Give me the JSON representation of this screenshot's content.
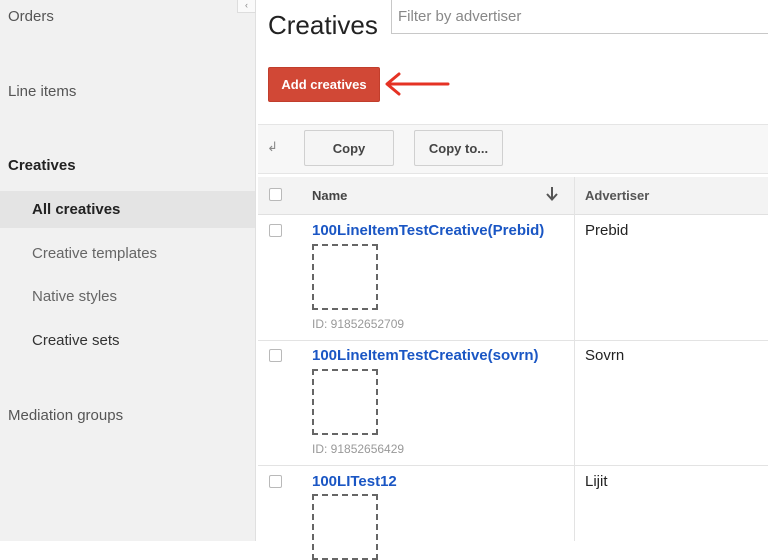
{
  "sidebar": {
    "collapse_label": "‹",
    "orders": "Orders",
    "line_items": "Line items",
    "creatives": "Creatives",
    "sub_items": [
      "All creatives",
      "Creative templates",
      "Native styles",
      "Creative sets"
    ],
    "mediation_groups": "Mediation groups"
  },
  "main": {
    "title": "Creatives",
    "filter_placeholder": "Filter by advertiser",
    "add_button": "Add creatives",
    "toolbar": {
      "sort_icon": "↲",
      "copy": "Copy",
      "copy_to": "Copy to..."
    },
    "columns": {
      "name": "Name",
      "advertiser": "Advertiser"
    },
    "rows": [
      {
        "name": "100LineItemTestCreative(Prebid)",
        "id": "ID: 91852652709",
        "advertiser": "Prebid"
      },
      {
        "name": "100LineItemTestCreative(sovrn)",
        "id": "ID: 91852656429",
        "advertiser": "Sovrn"
      },
      {
        "name": "100LITest12",
        "id": "",
        "advertiser": "Lijit"
      }
    ]
  },
  "colors": {
    "accent_button": "#d14836",
    "link": "#1a56c4",
    "annotation_arrow": "#e53224"
  }
}
